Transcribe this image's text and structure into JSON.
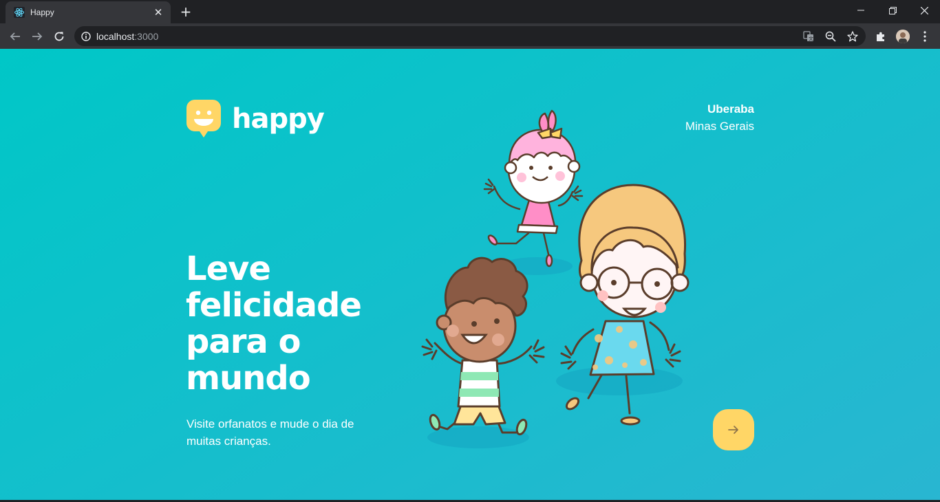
{
  "browser": {
    "tab_title": "Happy",
    "url_host": "localhost",
    "url_port": ":3000"
  },
  "colors": {
    "page_gradient_start": "#00C7C7",
    "page_gradient_end": "#29B6D1",
    "accent_yellow": "#FFD666",
    "text": "#FFFFFF"
  },
  "header": {
    "brand": "happy",
    "city": "Uberaba",
    "state": "Minas Gerais"
  },
  "hero": {
    "headline": "Leve felicidade para o mundo",
    "description": "Visite orfanatos e mude o dia de muitas crianças."
  },
  "icons": {
    "enter_button": "arrow-right-icon",
    "logo": "smiling-speech-bubble-logo",
    "illustration": "happy-children-illustration"
  }
}
